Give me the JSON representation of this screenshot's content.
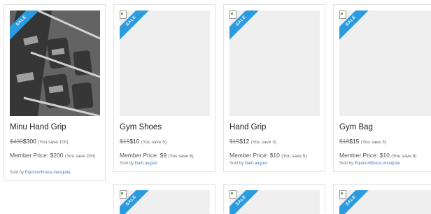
{
  "ribbon_text": "SALE",
  "colors": {
    "ribbon": "#2b9be0",
    "link": "#3a7fc4"
  },
  "products": [
    {
      "name": "Minu Hand Grip",
      "old_price": "$400",
      "new_price": "$300",
      "you_save": "(You save 100)",
      "member_price_label": "Member Price: $200",
      "member_save": "(You save 200)",
      "sold_by_prefix": "Sold by",
      "seller": "Equinoxfitness.mesquite"
    },
    {
      "name": "Gym Shoes",
      "old_price": "$15",
      "new_price": "$10",
      "you_save": "(You save 5)",
      "member_price_label": "Member Price: $9",
      "member_save": "(You save 6)",
      "sold_by_prefix": "Sold by",
      "seller": "Dain.august"
    },
    {
      "name": "Hand Grip",
      "old_price": "$15",
      "new_price": "$12",
      "you_save": "(You save 3)",
      "member_price_label": "Member Price: $10",
      "member_save": "(You save 5)",
      "sold_by_prefix": "Sold by",
      "seller": "Dain.august"
    },
    {
      "name": "Gym Bag",
      "old_price": "$18",
      "new_price": "$15",
      "you_save": "(You save 3)",
      "member_price_label": "Member Price: $10",
      "member_save": "(You save 8)",
      "sold_by_prefix": "Sold by",
      "seller": "Equinoxfitness.mesquite"
    }
  ]
}
